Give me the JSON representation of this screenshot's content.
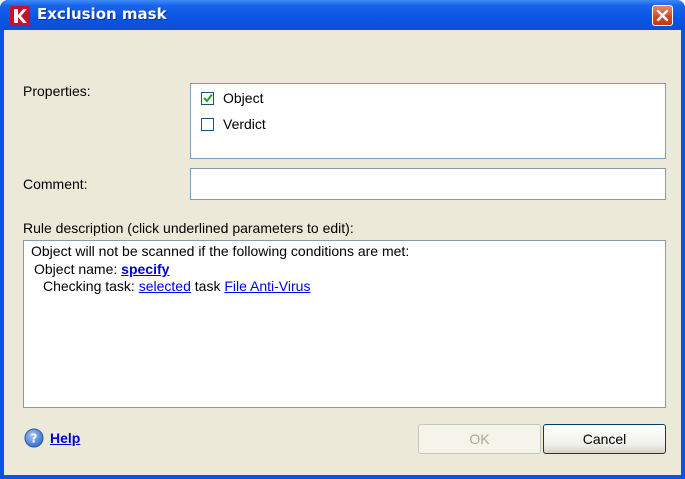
{
  "window": {
    "title": "Exclusion mask"
  },
  "form": {
    "properties_label": "Properties:",
    "properties": [
      {
        "label": "Object",
        "checked": true
      },
      {
        "label": "Verdict",
        "checked": false
      }
    ],
    "comment_label": "Comment:",
    "comment_value": "",
    "rule_label": "Rule description (click underlined parameters to edit):"
  },
  "rule": {
    "line1": "Object will not be scanned if the following conditions are met:",
    "object_name_prefix": "Object name: ",
    "object_name_link": "specify",
    "checking_prefix": "Checking task: ",
    "selected_link": "selected",
    "task_word": " task ",
    "task_link": "File Anti-Virus"
  },
  "footer": {
    "help_label": "Help",
    "ok_label": "OK",
    "cancel_label": "Cancel"
  },
  "colors": {
    "titlebar": "#0a55e3",
    "client": "#ece9d8",
    "link": "#0000ee"
  },
  "icons": {
    "app": "kaspersky-k-icon",
    "close": "close-x-icon",
    "help": "help-question-icon"
  }
}
